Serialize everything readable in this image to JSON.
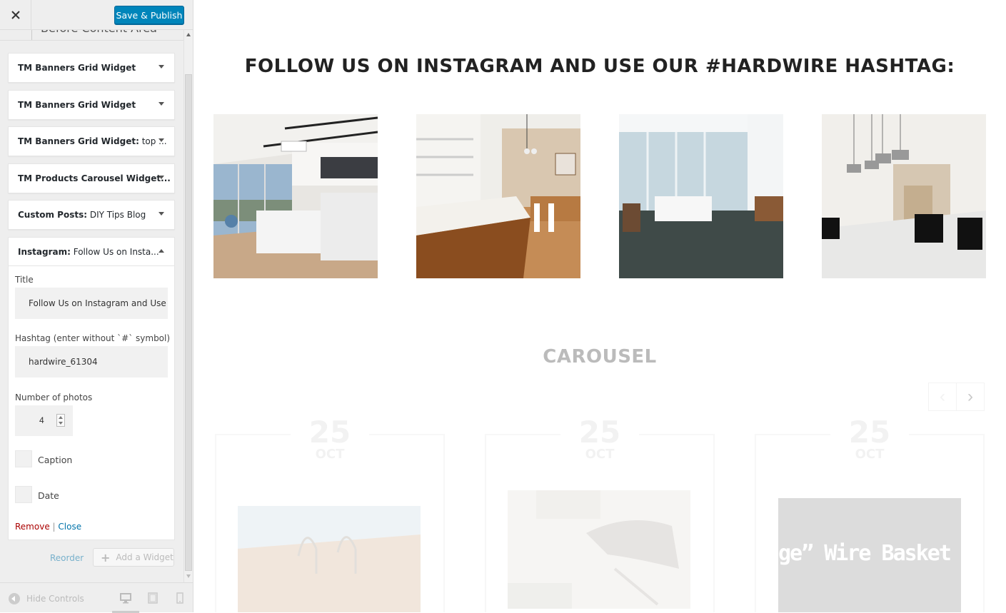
{
  "header": {
    "save_label": "Save & Publish"
  },
  "section": {
    "title": "Before Content Area"
  },
  "widgets": [
    {
      "name": "TM Banners Grid Widget",
      "sub": ""
    },
    {
      "name": "TM Banners Grid Widget",
      "sub": ""
    },
    {
      "name": "TM Banners Grid Widget:",
      "sub": " top ..."
    },
    {
      "name": "TM Products Carousel Widget...",
      "sub": ""
    },
    {
      "name": "Custom Posts:",
      "sub": " DIY Tips Blog"
    }
  ],
  "open_widget": {
    "name": "Instagram:",
    "sub": " Follow Us on Insta...",
    "title_label": "Title",
    "title_value": "Follow Us on Instagram and Use",
    "hashtag_label": "Hashtag (enter without `#` symbol)",
    "hashtag_value": "hardwire_61304",
    "photos_label": "Number of photos",
    "photos_value": "4",
    "caption_label": "Caption",
    "date_label": "Date",
    "remove_label": "Remove",
    "separator": "|",
    "close_label": "Close"
  },
  "footer_actions": {
    "reorder_label": "Reorder",
    "add_widget_label": "Add a Widget"
  },
  "footer": {
    "hide_controls_label": "Hide Controls",
    "devices": [
      "desktop-icon",
      "tablet-icon",
      "mobile-icon"
    ]
  },
  "preview": {
    "instagram_heading": "FOLLOW US ON INSTAGRAM AND USE OUR #HARDWIRE HASHTAG:",
    "carousel_heading": "CAROUSEL",
    "carousel_nav": {
      "prev": "‹",
      "next": "›"
    },
    "posts": [
      {
        "day": "25",
        "month": "OCT"
      },
      {
        "day": "25",
        "month": "OCT"
      },
      {
        "day": "25",
        "month": "OCT",
        "banner_text": "ge” Wire Basket From"
      }
    ]
  },
  "colors": {
    "primary_button": "#0085ba",
    "remove_link": "#aa0000",
    "link": "#0073aa"
  }
}
